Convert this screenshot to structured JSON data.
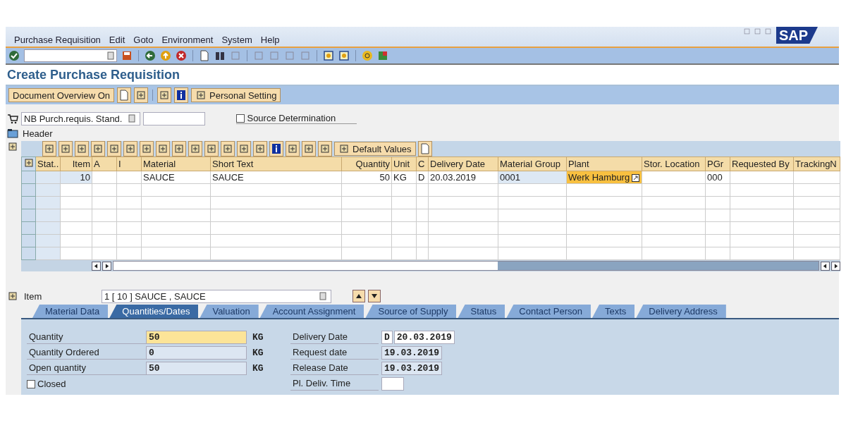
{
  "menu": [
    "Purchase Requisition",
    "Edit",
    "Goto",
    "Environment",
    "System",
    "Help"
  ],
  "logo": "SAP",
  "title": "Create Purchase Requisition",
  "app_toolbar": {
    "overview_button": "Document Overview On",
    "setting_button": "Personal Setting"
  },
  "document": {
    "type": "NB Purch.requis. Stand.",
    "source_determination": {
      "label": "Source Determination",
      "checked": false
    }
  },
  "header": {
    "label": "Header"
  },
  "grid_toolbar": {
    "default_values": "Default Values"
  },
  "table": {
    "columns": [
      {
        "label": "Stat..",
        "readonly": true
      },
      {
        "label": "Item",
        "readonly": true
      },
      {
        "label": "A",
        "readonly": false
      },
      {
        "label": "I",
        "readonly": false
      },
      {
        "label": "Material",
        "readonly": false
      },
      {
        "label": "Short Text",
        "readonly": false
      },
      {
        "label": "Quantity",
        "readonly": false
      },
      {
        "label": "Unit",
        "readonly": false
      },
      {
        "label": "C",
        "readonly": false
      },
      {
        "label": "Delivery Date",
        "readonly": false
      },
      {
        "label": "Material Group",
        "readonly": true
      },
      {
        "label": "Plant",
        "readonly": false
      },
      {
        "label": "Stor. Location",
        "readonly": false
      },
      {
        "label": "PGr",
        "readonly": false
      },
      {
        "label": "Requested By",
        "readonly": false
      },
      {
        "label": "TrackingN",
        "readonly": false
      }
    ],
    "rows": [
      {
        "cells": [
          null,
          {
            "text": "10",
            "focused": false
          },
          null,
          null,
          {
            "text": "SAUCE",
            "focused": false
          },
          {
            "text": "SAUCE",
            "focused": false
          },
          {
            "text": "50",
            "focused": false
          },
          {
            "text": "KG",
            "focused": false
          },
          {
            "text": "D",
            "focused": false
          },
          {
            "text": "20.03.2019",
            "focused": false
          },
          {
            "text": "0001",
            "focused": false
          },
          {
            "text": "Werk Hamburg",
            "focused": true
          },
          null,
          {
            "text": "000",
            "focused": false
          },
          null,
          null
        ]
      }
    ]
  },
  "item_selector": {
    "label": "Item",
    "value": "1 [ 10 ] SAUCE , SAUCE"
  },
  "tabs": [
    {
      "label": "Material Data",
      "selected": false
    },
    {
      "label": "Quantities/Dates",
      "selected": true
    },
    {
      "label": "Valuation",
      "selected": false
    },
    {
      "label": "Account Assignment",
      "selected": false
    },
    {
      "label": "Source of Supply",
      "selected": false
    },
    {
      "label": "Status",
      "selected": false
    },
    {
      "label": "Contact Person",
      "selected": false
    },
    {
      "label": "Texts",
      "selected": false
    },
    {
      "label": "Delivery Address",
      "selected": false
    }
  ],
  "quantities": [
    {
      "label": "Quantity",
      "value": "50",
      "unit": "KG",
      "editable": true
    },
    {
      "label": "Quantity Ordered",
      "value": "0",
      "unit": "KG",
      "editable": false
    },
    {
      "label": "Open quantity",
      "value": "50",
      "unit": "KG",
      "editable": false
    }
  ],
  "closed": {
    "label": "Closed",
    "checked": false
  },
  "dates": [
    {
      "label": "Delivery Date",
      "indicator": "D",
      "value": "20.03.2019",
      "editable": true
    },
    {
      "label": "Request date",
      "value": "19.03.2019",
      "editable": false
    },
    {
      "label": "Release Date",
      "value": "19.03.2019",
      "editable": false
    },
    {
      "label": "Pl. Deliv. Time",
      "editable": true
    }
  ]
}
